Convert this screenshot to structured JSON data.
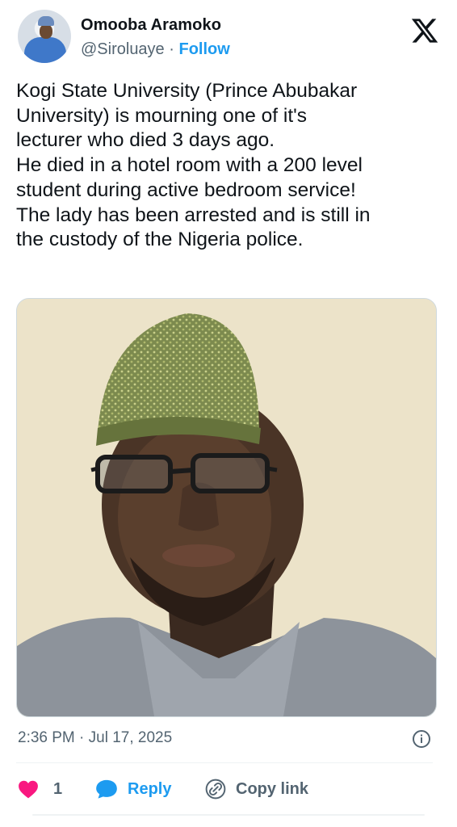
{
  "author": {
    "name": "Omooba Aramoko",
    "handle": "@Siroluaye",
    "separator": "·",
    "follow_label": "Follow"
  },
  "tweet": {
    "text": "Kogi State University (Prince Abubakar\nUniversity) is mourning one of it's\nlecturer who died 3 days ago.\nHe died in a hotel room with a 200 level\nstudent during  active bedroom service!\nThe lady has been arrested and is still in\nthe custody of the Nigeria police.",
    "timestamp": "2:36 PM · Jul 17, 2025"
  },
  "actions": {
    "like_count": "1",
    "reply_label": "Reply",
    "copy_label": "Copy link"
  },
  "colors": {
    "accent": "#1d9bf0",
    "like": "#f91880",
    "muted": "#536471"
  },
  "icons": [
    "x-logo-icon",
    "info-icon",
    "heart-icon",
    "reply-bubble-icon",
    "link-icon"
  ]
}
